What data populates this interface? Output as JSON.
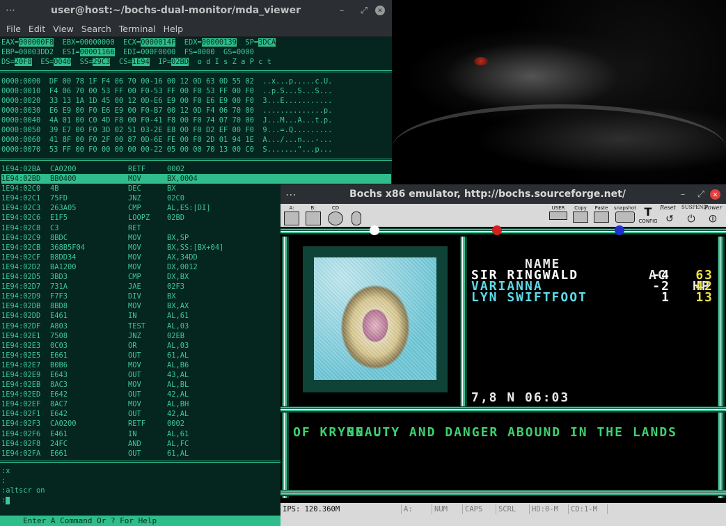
{
  "terminal": {
    "title": "user@host:~/bochs-dual-monitor/mda_viewer",
    "menu": [
      "File",
      "Edit",
      "View",
      "Search",
      "Terminal",
      "Help"
    ],
    "registers": [
      [
        {
          "t": "EAX="
        },
        {
          "t": "000000F8",
          "h": true
        },
        {
          "t": "  EBX=00000000  ECX="
        },
        {
          "t": "0000014F",
          "h": true
        },
        {
          "t": "  EDX="
        },
        {
          "t": "00000139",
          "h": true
        },
        {
          "t": "  SP="
        },
        {
          "t": "3DCA",
          "h": true
        }
      ],
      [
        {
          "t": "EBP=00003DD2  ESI="
        },
        {
          "t": "00001166",
          "h": true
        },
        {
          "t": "  EDI=000F0000  FS=0000  GS=0000"
        }
      ],
      [
        {
          "t": "DS="
        },
        {
          "t": "20F8",
          "h": true
        },
        {
          "t": "  ES="
        },
        {
          "t": "0040",
          "h": true
        },
        {
          "t": "  SS="
        },
        {
          "t": "29C3",
          "h": true
        },
        {
          "t": "  CS="
        },
        {
          "t": "1E94",
          "h": true
        },
        {
          "t": "  IP="
        },
        {
          "t": "02BD",
          "h": true
        },
        {
          "t": "  o d I s Z a P c t"
        }
      ]
    ],
    "dump": [
      "0000:0000  DF 00 78 1F F4 06 70 00-16 00 12 0D 63 0D 55 02  ..x...p.....c.U.",
      "0000:0010  F4 06 70 00 53 FF 00 F0-53 FF 00 F0 53 FF 00 F0  ..p.S...S...S...",
      "0000:0020  33 13 1A 1D 45 00 12 0D-E6 E9 00 F0 E6 E9 00 F0  3...E...........",
      "0000:0030  E6 E9 00 F0 E6 E9 00 F0-B7 00 12 0D F4 06 70 00  ..............p.",
      "0000:0040  4A 01 00 C0 4D F8 00 F0-41 F8 00 F0 74 07 70 00  J...M...A...t.p.",
      "0000:0050  39 E7 00 F0 3D 02 51 03-2E E8 00 F0 D2 EF 00 F0  9...=.Q.........",
      "0000:0060  41 8F 00 F0 2F 00 87 0D-6E FE 00 F0 2D 01 94 1E  A.../...n...-...",
      "0000:0070  53 FF 00 F0 00 00 00 00-22 05 00 00 70 13 00 C0  S.......\"...p..."
    ],
    "disasm": [
      {
        "addr": "1E94:02BA",
        "hex": "CA0200",
        "op": "RETF",
        "arg": "0002"
      },
      {
        "addr": "1E94:02BD",
        "hex": "BB0400",
        "op": "MOV",
        "arg": "BX,0004",
        "selected": true
      },
      {
        "addr": "1E94:02C0",
        "hex": "4B",
        "op": "DEC",
        "arg": "BX"
      },
      {
        "addr": "1E94:02C1",
        "hex": "75FD",
        "op": "JNZ",
        "arg": "02C0"
      },
      {
        "addr": "1E94:02C3",
        "hex": "263A05",
        "op": "CMP",
        "arg": "AL,ES:[DI]"
      },
      {
        "addr": "1E94:02C6",
        "hex": "E1F5",
        "op": "LOOPZ",
        "arg": "02BD"
      },
      {
        "addr": "1E94:02C8",
        "hex": "C3",
        "op": "RET",
        "arg": ""
      },
      {
        "addr": "1E94:02C9",
        "hex": "8BDC",
        "op": "MOV",
        "arg": "BX,SP"
      },
      {
        "addr": "1E94:02CB",
        "hex": "368B5F04",
        "op": "MOV",
        "arg": "BX,SS:[BX+04]"
      },
      {
        "addr": "1E94:02CF",
        "hex": "B8DD34",
        "op": "MOV",
        "arg": "AX,34DD"
      },
      {
        "addr": "1E94:02D2",
        "hex": "BA1200",
        "op": "MOV",
        "arg": "DX,0012"
      },
      {
        "addr": "1E94:02D5",
        "hex": "3BD3",
        "op": "CMP",
        "arg": "DX,BX"
      },
      {
        "addr": "1E94:02D7",
        "hex": "731A",
        "op": "JAE",
        "arg": "02F3"
      },
      {
        "addr": "1E94:02D9",
        "hex": "F7F3",
        "op": "DIV",
        "arg": "BX"
      },
      {
        "addr": "1E94:02DB",
        "hex": "8BD8",
        "op": "MOV",
        "arg": "BX,AX"
      },
      {
        "addr": "1E94:02DD",
        "hex": "E461",
        "op": "IN",
        "arg": "AL,61"
      },
      {
        "addr": "1E94:02DF",
        "hex": "A803",
        "op": "TEST",
        "arg": "AL,03"
      },
      {
        "addr": "1E94:02E1",
        "hex": "7508",
        "op": "JNZ",
        "arg": "02EB"
      },
      {
        "addr": "1E94:02E3",
        "hex": "0C03",
        "op": "OR",
        "arg": "AL,03"
      },
      {
        "addr": "1E94:02E5",
        "hex": "E661",
        "op": "OUT",
        "arg": "61,AL"
      },
      {
        "addr": "1E94:02E7",
        "hex": "B0B6",
        "op": "MOV",
        "arg": "AL,B6"
      },
      {
        "addr": "1E94:02E9",
        "hex": "E643",
        "op": "OUT",
        "arg": "43,AL"
      },
      {
        "addr": "1E94:02EB",
        "hex": "8AC3",
        "op": "MOV",
        "arg": "AL,BL"
      },
      {
        "addr": "1E94:02ED",
        "hex": "E642",
        "op": "OUT",
        "arg": "42,AL"
      },
      {
        "addr": "1E94:02EF",
        "hex": "8AC7",
        "op": "MOV",
        "arg": "AL,BH"
      },
      {
        "addr": "1E94:02F1",
        "hex": "E642",
        "op": "OUT",
        "arg": "42,AL"
      },
      {
        "addr": "1E94:02F3",
        "hex": "CA0200",
        "op": "RETF",
        "arg": "0002"
      },
      {
        "addr": "1E94:02F6",
        "hex": "E461",
        "op": "IN",
        "arg": "AL,61"
      },
      {
        "addr": "1E94:02F8",
        "hex": "24FC",
        "op": "AND",
        "arg": "AL,FC"
      },
      {
        "addr": "1E94:02FA",
        "hex": "E661",
        "op": "OUT",
        "arg": "61,AL"
      }
    ],
    "command_lines": [
      ":x",
      ":",
      ":altscr on",
      ":"
    ],
    "status": "     Enter A Command Or ? For Help"
  },
  "bochs": {
    "title": "Bochs x86 emulator, http://bochs.sourceforge.net/",
    "toolbar": {
      "floppy_a": "A:",
      "floppy_b": "B:",
      "cdrom": "CD",
      "user": "USER",
      "copy": "Copy",
      "paste": "Paste",
      "snapshot": "snapshot",
      "config": "CONFIG",
      "reset": "Reset",
      "suspend": "SUSPEND",
      "power": "Power"
    },
    "game": {
      "header": {
        "name": "NAME",
        "ac": "AC",
        "hp": "HP"
      },
      "party": [
        {
          "name": "SIR RINGWALD",
          "ac": "-4",
          "hp": "63",
          "color": "#ffffff"
        },
        {
          "name": "VARIANNA",
          "ac": "-2",
          "hp": "42",
          "color": "#5fd8e8"
        },
        {
          "name": "LYN SWIFTFOOT",
          "ac": "1",
          "hp": "13",
          "color": "#5fd8e8"
        }
      ],
      "coords": "7,8 N 06:03",
      "message_line1": "BEAUTY AND DANGER ABOUND IN THE LANDS",
      "message_line2": "OF KRYNN ...",
      "hp_color": "#f0e040",
      "ac_color": "#ffffff"
    },
    "status": {
      "ips": "IPS: 120.360M",
      "a": "A:",
      "num": "NUM",
      "caps": "CAPS",
      "scrl": "SCRL",
      "hd": "HD:0-M",
      "cd": "CD:1-M"
    }
  }
}
